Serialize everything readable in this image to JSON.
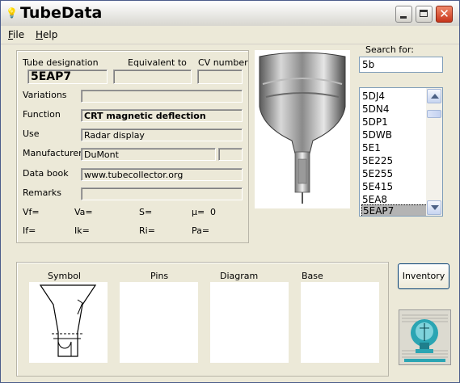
{
  "app": {
    "title": "TubeData"
  },
  "menu": {
    "file_accel": "F",
    "file_rest": "ile",
    "help_accel": "H",
    "help_rest": "elp"
  },
  "details": {
    "tube_designation_label": "Tube designation",
    "tube_designation_value": "5EAP7",
    "equivalent_label": "Equivalent to",
    "equivalent_value": "",
    "cv_label": "CV number",
    "cv_value": "",
    "variations_label": "Variations",
    "variations_value": "",
    "function_label": "Function",
    "function_value": "CRT magnetic deflection",
    "use_label": "Use",
    "use_value": "Radar display",
    "manufacturer_label": "Manufacturer",
    "manufacturer_value": "DuMont",
    "manufacturer_extra": "",
    "databook_label": "Data book",
    "databook_value": "www.tubecollector.org",
    "remarks_label": "Remarks",
    "remarks_value": ""
  },
  "params": {
    "vf": "Vf=",
    "va": "Va=",
    "s": "S=",
    "mu": "µ=",
    "mu_value": "0",
    "if": "If=",
    "ik": "Ik=",
    "ri": "Ri=",
    "pa": "Pa="
  },
  "search": {
    "label": "Search for:",
    "value": "5b"
  },
  "list": {
    "items": [
      "5DJ4",
      "5DN4",
      "5DP1",
      "5DWB",
      "5E1",
      "5E225",
      "5E255",
      "5E415",
      "5EA8",
      "5EAP7"
    ],
    "selected": "5EAP7"
  },
  "images": {
    "symbol_label": "Symbol",
    "pins_label": "Pins",
    "diagram_label": "Diagram",
    "base_label": "Base"
  },
  "buttons": {
    "inventory": "Inventory"
  },
  "icons": {
    "app": "bulb-icon",
    "minimize": "minimize-icon",
    "maximize": "maximize-icon",
    "close": "close-icon"
  }
}
